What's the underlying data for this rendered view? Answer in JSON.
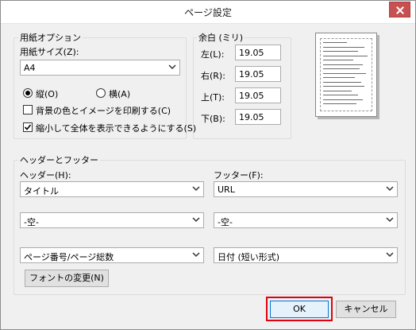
{
  "window": {
    "title": "ページ設定"
  },
  "paper": {
    "group_label": "用紙オプション",
    "size_label": "用紙サイズ(Z):",
    "size_value": "A4",
    "portrait_label": "縦(O)",
    "landscape_label": "横(A)",
    "orientation_selected": "portrait",
    "print_background_label": "背景の色とイメージを印刷する(C)",
    "print_background_checked": false,
    "shrink_to_fit_label": "縮小して全体を表示できるようにする(S)",
    "shrink_to_fit_checked": true
  },
  "margins": {
    "group_label": "余白 (ミリ)",
    "left_label": "左(L):",
    "left_value": "19.05",
    "right_label": "右(R):",
    "right_value": "19.05",
    "top_label": "上(T):",
    "top_value": "19.05",
    "bottom_label": "下(B):",
    "bottom_value": "19.05"
  },
  "header_footer": {
    "group_label": "ヘッダーとフッター",
    "header_label": "ヘッダー(H):",
    "footer_label": "フッター(F):",
    "header_values": [
      "タイトル",
      "-空-",
      "ページ番号/ページ総数"
    ],
    "footer_values": [
      "URL",
      "-空-",
      "日付 (短い形式)"
    ],
    "font_button": "フォントの変更(N)"
  },
  "buttons": {
    "ok": "OK",
    "cancel": "キャンセル"
  },
  "icons": {
    "close": "close-icon",
    "dropdown": "chevron-down-icon",
    "check": "check-icon"
  }
}
